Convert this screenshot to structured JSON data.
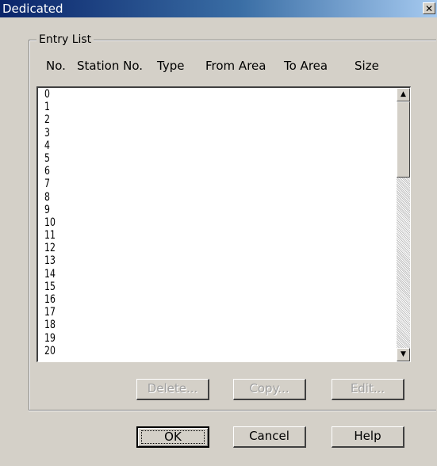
{
  "window": {
    "title": "Dedicated",
    "close_glyph": "✕"
  },
  "group": {
    "label": "Entry List"
  },
  "columns": [
    "No.",
    "Station No.",
    "Type",
    "From Area",
    "To Area",
    "Size"
  ],
  "list": {
    "rows": [
      "0",
      "1",
      "2",
      "3",
      "4",
      "5",
      "6",
      "7",
      "8",
      "9",
      "10",
      "11",
      "12",
      "13",
      "14",
      "15",
      "16",
      "17",
      "18",
      "19",
      "20"
    ]
  },
  "scrollbar": {
    "up_glyph": "▲",
    "down_glyph": "▼"
  },
  "actions": {
    "delete_label": "Delete...",
    "copy_label": "Copy...",
    "edit_label": "Edit..."
  },
  "footer": {
    "ok_label": "OK",
    "cancel_label": "Cancel",
    "help_label": "Help"
  }
}
